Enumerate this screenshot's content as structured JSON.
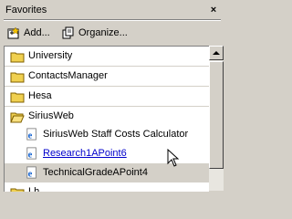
{
  "panel": {
    "title": "Favorites",
    "close_glyph": "×"
  },
  "toolbar": {
    "add_label": "Add...",
    "add_icon": "add-favorite-icon",
    "organize_label": "Organize...",
    "organize_icon": "organize-favorites-icon"
  },
  "favorites": {
    "items": [
      {
        "label": "University",
        "icon": "folder-icon",
        "type": "folder"
      },
      {
        "label": "ContactsManager",
        "icon": "folder-icon",
        "type": "folder"
      },
      {
        "label": "Hesa",
        "icon": "folder-icon",
        "type": "folder"
      },
      {
        "label": "SiriusWeb",
        "icon": "open-folder-icon",
        "type": "folder-open"
      },
      {
        "label": "SiriusWeb Staff Costs Calculator",
        "icon": "ie-page-icon",
        "type": "link"
      },
      {
        "label": "Research1APoint6",
        "icon": "ie-page-icon",
        "type": "link-hover"
      },
      {
        "label": "TechnicalGradeAPoint4",
        "icon": "ie-page-icon",
        "type": "link-selected"
      },
      {
        "label": "Lh",
        "icon": "folder-icon",
        "type": "folder"
      }
    ]
  },
  "colors": {
    "chrome": "#d4d0c8",
    "folder": "#f0d050",
    "link_hover": "#0000cc"
  }
}
